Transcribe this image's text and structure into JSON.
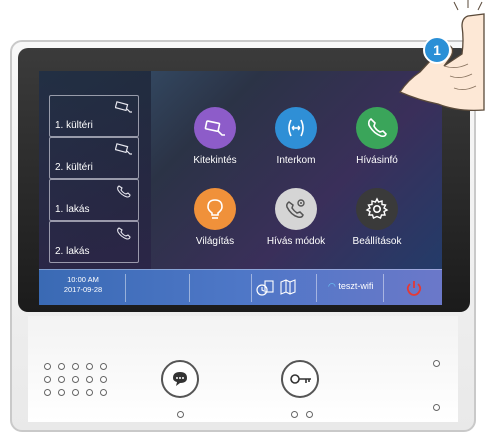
{
  "contacts": [
    {
      "label": "1. kültéri",
      "icon": "camera-icon"
    },
    {
      "label": "2. kültéri",
      "icon": "camera-icon"
    },
    {
      "label": "1. lakás",
      "icon": "phone-icon"
    },
    {
      "label": "2. lakás",
      "icon": "phone-icon"
    }
  ],
  "apps": [
    {
      "label": "Kitekintés",
      "icon": "camera-icon",
      "color": "#8d5cc9"
    },
    {
      "label": "Interkom",
      "icon": "intercom-arrows-icon",
      "color": "#2f8fd6"
    },
    {
      "label": "Hívásinfó",
      "icon": "phone-icon",
      "color": "#3aa55a"
    },
    {
      "label": "Világítás",
      "icon": "bulb-icon",
      "color": "#f0913a"
    },
    {
      "label": "Hívás módok",
      "icon": "phone-settings-icon",
      "color": "#d5d5d5"
    },
    {
      "label": "Beállítások",
      "icon": "gear-icon",
      "color": "#3a3a3a"
    }
  ],
  "status": {
    "time": "10:00 AM",
    "date": "2017-09-28",
    "wifi": "teszt-wifi"
  },
  "callout": {
    "number": "1",
    "color": "#2a8fd6"
  },
  "accent": {
    "power": "#e53935",
    "status_bar": "#4e77c7"
  }
}
